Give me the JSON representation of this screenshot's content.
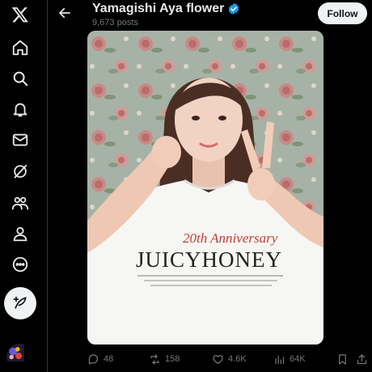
{
  "nav": {
    "items": [
      {
        "name": "x-logo-icon"
      },
      {
        "name": "home-icon"
      },
      {
        "name": "search-icon"
      },
      {
        "name": "notifications-icon"
      },
      {
        "name": "messages-icon"
      },
      {
        "name": "grok-icon"
      },
      {
        "name": "communities-icon"
      },
      {
        "name": "profile-icon"
      },
      {
        "name": "more-icon"
      }
    ],
    "compose_icon": "compose-post-icon"
  },
  "header": {
    "back_icon": "back-arrow-icon",
    "title": "Yamagishi Aya flower",
    "verified_icon": "verified-badge-icon",
    "verified_color": "#1d9bf0",
    "posts_count": "9,673 posts",
    "follow_label": "Follow"
  },
  "media": {
    "shirt_line1": "20th Anniversary",
    "shirt_line2": "JUICYHONEY"
  },
  "actions": {
    "replies": "48",
    "reposts": "158",
    "likes": "4.6K",
    "views": "64K"
  },
  "colors": {
    "background": "#000000",
    "text_primary": "#e7e9ea",
    "text_secondary": "#71767b",
    "button_light": "#eff3f4",
    "accent": "#1d9bf0"
  }
}
